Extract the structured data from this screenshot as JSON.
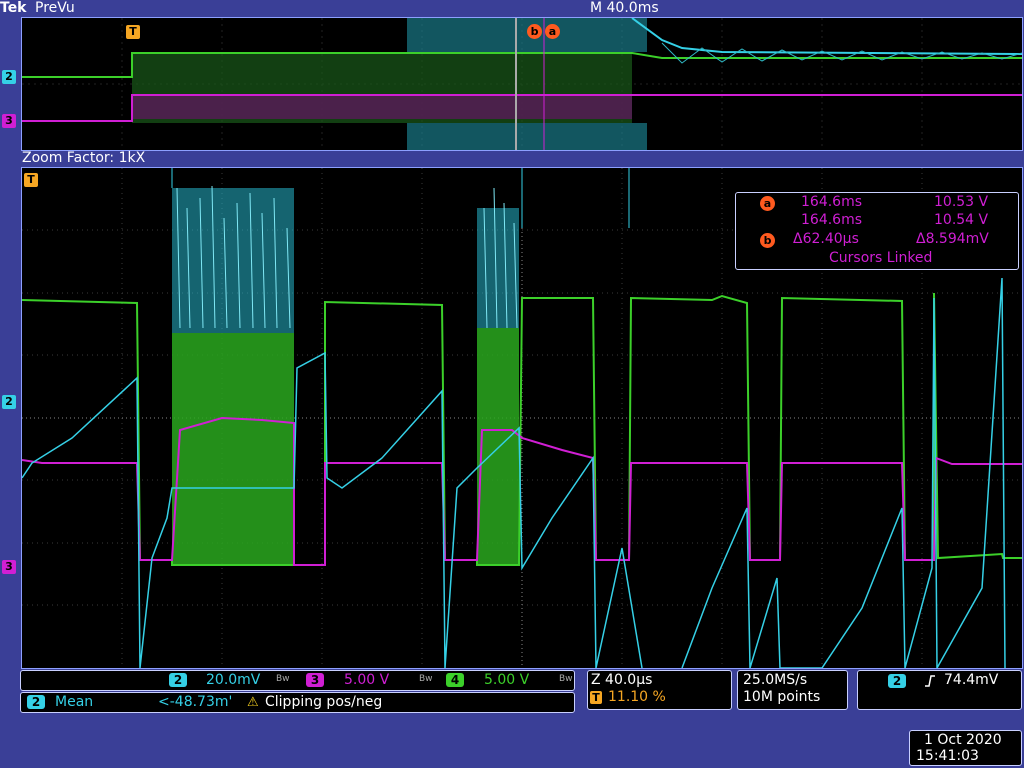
{
  "header": {
    "brand": "Tek",
    "mode": "PreVu",
    "timebase": "M 40.0ms"
  },
  "zoom": {
    "label": "Zoom Factor: 1kX"
  },
  "markers": {
    "trigger": "T",
    "ch2": "2",
    "ch3": "3"
  },
  "cursors": {
    "a_label": "a",
    "b_label": "b",
    "a_time": "164.6ms",
    "a_volt": "10.53 V",
    "a2_time": "164.6ms",
    "a2_volt": "10.54 V",
    "delta_time": "Δ62.40µs",
    "delta_volt": "Δ8.594mV",
    "linked": "Cursors Linked"
  },
  "channels": {
    "ch2": {
      "num": "2",
      "scale": "20.0mV",
      "color": "#35d0e6"
    },
    "ch3": {
      "num": "3",
      "scale": "5.00 V",
      "color": "#d01fd4"
    },
    "ch4": {
      "num": "4",
      "scale": "5.00 V",
      "color": "#3cd02a"
    },
    "bw_symbol": "Bᴡ"
  },
  "measurement": {
    "ch": "2",
    "name": "Mean",
    "value": "<-48.73m'",
    "warning": "Clipping pos/neg"
  },
  "horizontal": {
    "zoom_pos": "Z 40.0µs",
    "trigger_pos": "11.10 %",
    "trigger_marker": "T"
  },
  "acquisition": {
    "rate": "25.0MS/s",
    "points": "10M points"
  },
  "trigger": {
    "ch": "2",
    "slope_icon": "rising-edge-icon",
    "level": "74.4mV"
  },
  "datetime": {
    "date": "1 Oct  2020",
    "time": "15:41:03"
  }
}
